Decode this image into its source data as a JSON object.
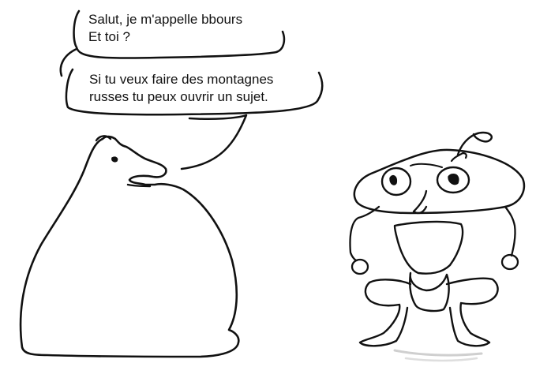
{
  "colors": {
    "background": "#ffffff",
    "ink": "#111111",
    "shadow": "#d0d0d0"
  },
  "dialogue": {
    "bubble1": {
      "line1": "Salut, je m'appelle bbours",
      "line2": "Et toi ?"
    },
    "bubble2": {
      "line1": "Si tu veux faire des montagnes",
      "line2": "russes tu peux ouvrir un sujet."
    }
  }
}
